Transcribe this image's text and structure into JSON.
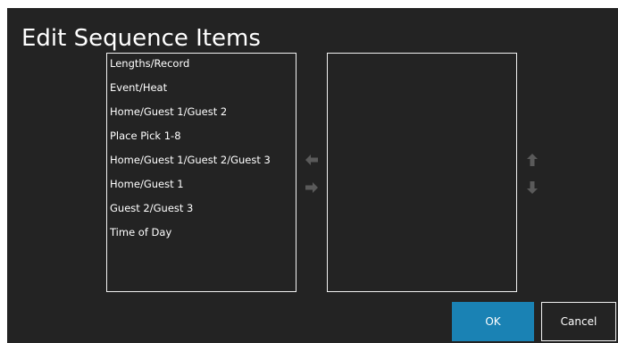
{
  "dialog": {
    "title": "Edit Sequence Items"
  },
  "available_list": {
    "items": [
      "Lengths/Record",
      "Event/Heat",
      "Home/Guest 1/Guest 2",
      "Place Pick 1-8",
      "Home/Guest 1/Guest 2/Guest 3",
      "Home/Guest 1",
      "Guest 2/Guest 3",
      "Time of Day"
    ]
  },
  "sequence_list": {
    "items": []
  },
  "controls": {
    "move_left_icon": "arrow-left-icon",
    "move_right_icon": "arrow-right-icon",
    "move_up_icon": "arrow-up-icon",
    "move_down_icon": "arrow-down-icon",
    "icon_color_disabled": "#5a5a5a"
  },
  "buttons": {
    "ok_label": "OK",
    "cancel_label": "Cancel",
    "accent_color": "#1a82b4"
  }
}
